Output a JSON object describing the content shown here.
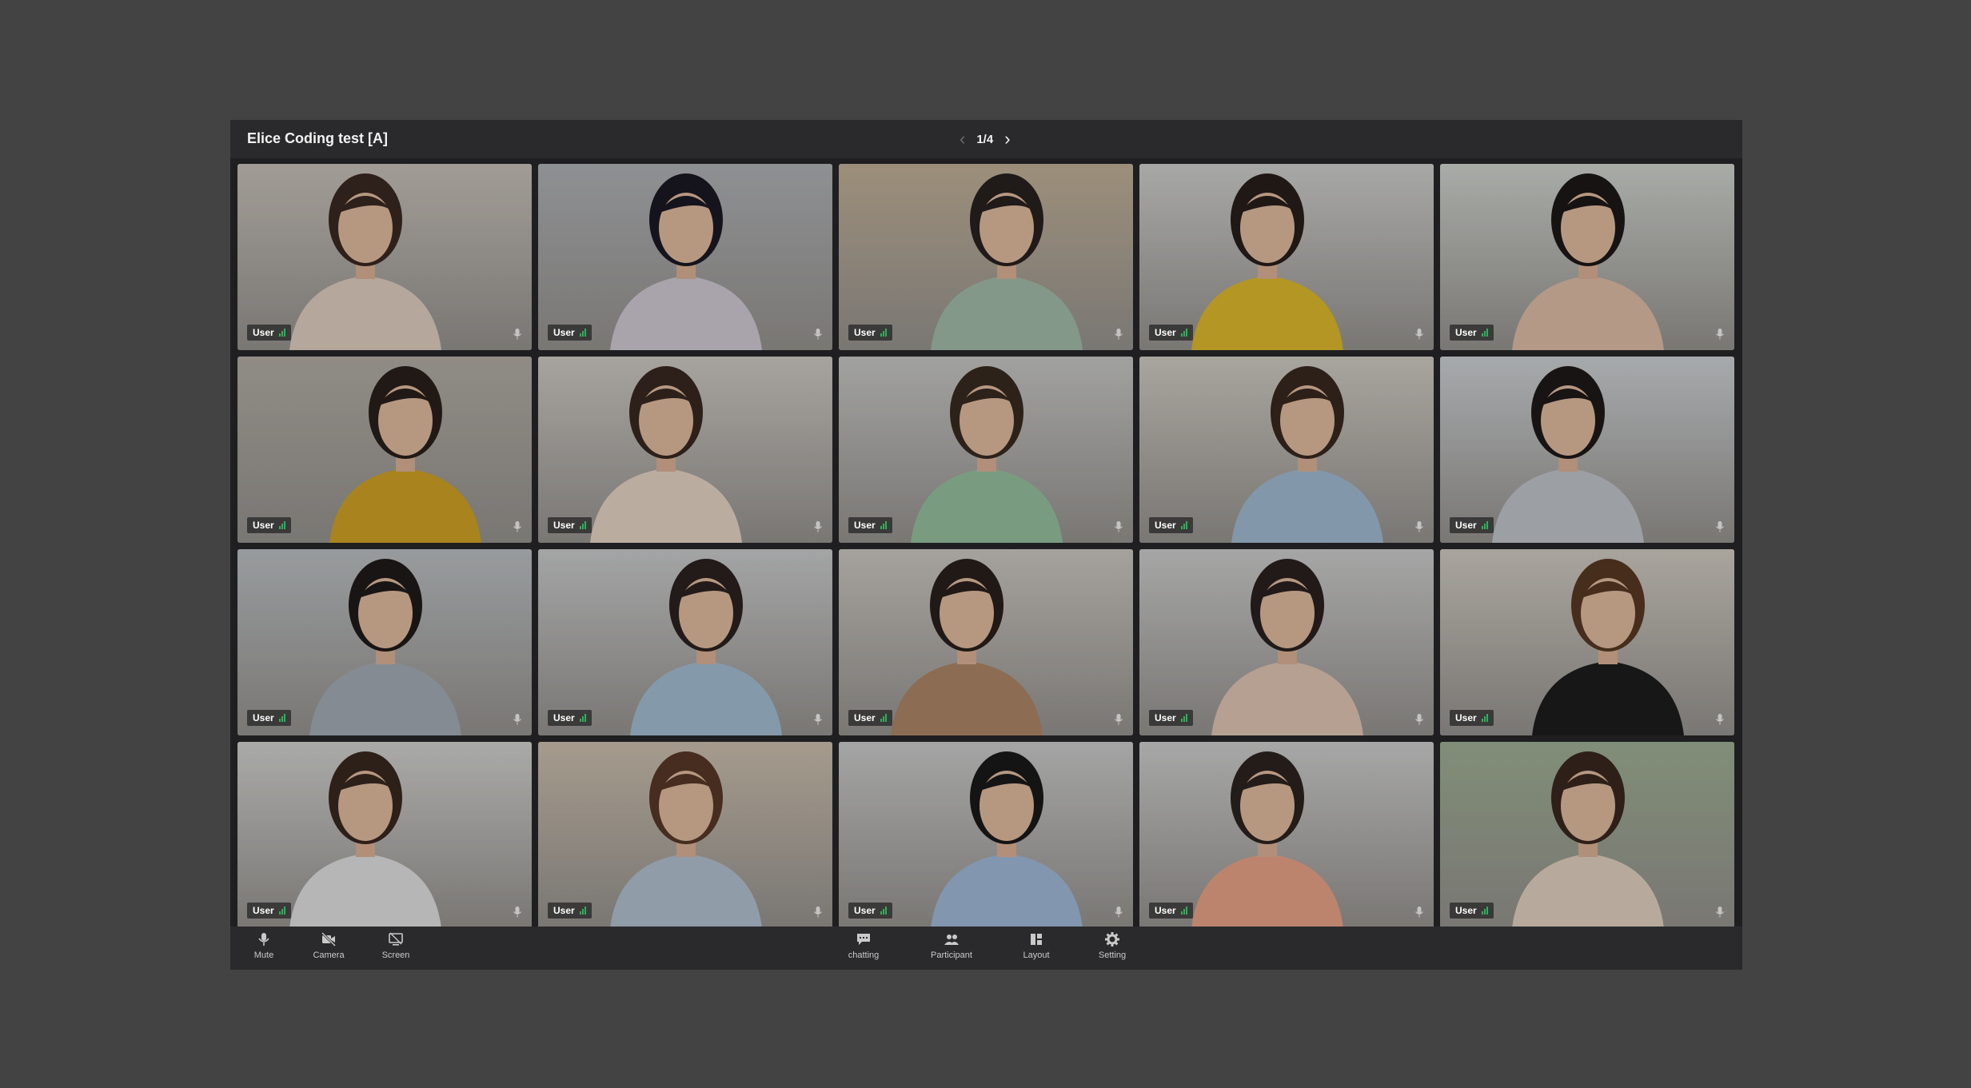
{
  "app": {
    "title": "Elice Coding test [A]",
    "page_indicator": "1/4"
  },
  "participants": [
    {
      "label": "User",
      "bg": "#cfc8c0",
      "shirt": "#e8d6c8",
      "hair": "#3b2a22"
    },
    {
      "label": "User",
      "bg": "#b7b9bd",
      "shirt": "#d9d3dd",
      "hair": "#1c1a24"
    },
    {
      "label": "User",
      "bg": "#c9b89e",
      "shirt": "#a9c3b0",
      "hair": "#2a2220"
    },
    {
      "label": "User",
      "bg": "#d7d7d5",
      "shirt": "#e6c02e",
      "hair": "#2a1f1c"
    },
    {
      "label": "User",
      "bg": "#d8dcd6",
      "shirt": "#e7c5ae",
      "hair": "#1d1918"
    },
    {
      "label": "User",
      "bg": "#b9b4ab",
      "shirt": "#d9a827",
      "hair": "#2b211c"
    },
    {
      "label": "User",
      "bg": "#d6d2cc",
      "shirt": "#f0ddcd",
      "hair": "#3a2a22"
    },
    {
      "label": "User",
      "bg": "#cfcfcd",
      "shirt": "#9cc8a6",
      "hair": "#3a2c22"
    },
    {
      "label": "User",
      "bg": "#d8d3cb",
      "shirt": "#a8c2dc",
      "hair": "#3a2a20"
    },
    {
      "label": "User",
      "bg": "#d6dadd",
      "shirt": "#c8ccd2",
      "hair": "#1f1a1a"
    },
    {
      "label": "User",
      "bg": "#c3c7ca",
      "shirt": "#a9b3bc",
      "hair": "#201c1a"
    },
    {
      "label": "User",
      "bg": "#d2d3d4",
      "shirt": "#a9c6dc",
      "hair": "#2d2320"
    },
    {
      "label": "User",
      "bg": "#d4d0ca",
      "shirt": "#b48b6a",
      "hair": "#2a211b"
    },
    {
      "label": "User",
      "bg": "#d5d5d5",
      "shirt": "#eacdbb",
      "hair": "#2b2220"
    },
    {
      "label": "User",
      "bg": "#d9d3c9",
      "shirt": "#1e1e1e",
      "hair": "#5a3a25"
    },
    {
      "label": "User",
      "bg": "#dadad7",
      "shirt": "#e9e9ea",
      "hair": "#3a2a20"
    },
    {
      "label": "User",
      "bg": "#d4c7b5",
      "shirt": "#b9c8d6",
      "hair": "#5a3a28"
    },
    {
      "label": "User",
      "bg": "#d3d3d3",
      "shirt": "#a8c1e0",
      "hair": "#1c1a1a"
    },
    {
      "label": "User",
      "bg": "#d6d6d6",
      "shirt": "#f2a98c",
      "hair": "#2e2421"
    },
    {
      "label": "User",
      "bg": "#a5b69a",
      "shirt": "#ebdac8",
      "hair": "#3b2a1f"
    }
  ],
  "toolbar": {
    "left": [
      {
        "label": "Mute",
        "icon": "microphone-icon"
      },
      {
        "label": "Camera",
        "icon": "camera-off-icon"
      },
      {
        "label": "Screen",
        "icon": "screen-share-off-icon"
      }
    ],
    "center": [
      {
        "label": "chatting",
        "icon": "chat-icon"
      },
      {
        "label": "Participant",
        "icon": "participants-icon"
      },
      {
        "label": "Layout",
        "icon": "layout-icon"
      },
      {
        "label": "Setting",
        "icon": "gear-icon"
      }
    ]
  },
  "colors": {
    "background": "#434343",
    "window": "#1f1f21",
    "bars": "#2a2a2c",
    "signal": "#2fb05a"
  }
}
